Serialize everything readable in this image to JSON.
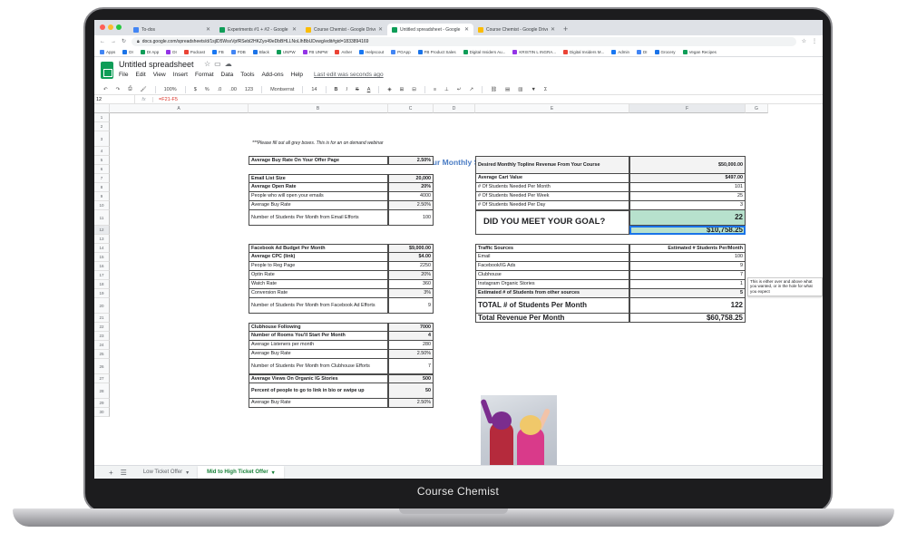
{
  "device_label": "Course Chemist",
  "browser": {
    "tabs": [
      {
        "label": "To-dos",
        "color": "#4285f4"
      },
      {
        "label": "Experiments #1 + #2 - Google",
        "color": "#0f9d58"
      },
      {
        "label": "Course Chemist - Google Drive",
        "color": "#fbbc04"
      },
      {
        "label": "Untitled spreadsheet - Google",
        "color": "#0f9d58"
      },
      {
        "label": "Course Chemist - Google Drive",
        "color": "#fbbc04"
      }
    ],
    "url": "docs.google.com/spreadsheets/d/1sjlD5WsxVpfRSebl2HKZyo49eDbBHLLNoLlhBbUDvwg/edit#gid=1833894169",
    "bookmarks": [
      "Apps",
      "DI",
      "DI App",
      "DI",
      "Podcast",
      "FB",
      "FDB",
      "Black",
      "UNPW",
      "FB UNPW",
      "Asher",
      "Helpscout",
      "PGApp",
      "FB Product Sales",
      "Digital Insiders Au...",
      "KRISTIN L INGRA...",
      "Digital Insiders M...",
      "Admin",
      "DI",
      "Grocery",
      "Vegan Recipes"
    ]
  },
  "sheets": {
    "title": "Untitled spreadsheet",
    "menu": [
      "File",
      "Edit",
      "View",
      "Insert",
      "Format",
      "Data",
      "Tools",
      "Add-ons",
      "Help"
    ],
    "last_edit": "Last edit was seconds ago",
    "toolbar": {
      "zoom": "100%",
      "currency": "$",
      "percent": "%",
      "dec_less": ".0",
      "dec_more": ".00",
      "format": "123",
      "font": "Montserrat",
      "size": "14",
      "bold": "B",
      "italic": "I",
      "strike": "S",
      "textcolor": "A",
      "sigma": "Σ"
    },
    "name_box": "12",
    "formula": "=F21-F5",
    "columns": [
      "A",
      "B",
      "C",
      "D",
      "E",
      "F",
      "G"
    ],
    "rows": [
      "1",
      "2",
      "3",
      "4",
      "5",
      "6",
      "7",
      "8",
      "9",
      "10",
      "11",
      "12",
      "13",
      "14",
      "15",
      "16",
      "17",
      "18",
      "19",
      "20",
      "21",
      "22",
      "23",
      "24",
      "25",
      "26",
      "27",
      "28",
      "29",
      "30"
    ],
    "heading": "Estimate Your Monthly Sales Based on Traffic Efforts",
    "instructions": "***Please fill out all grey boxes. This is for an on demand webinar",
    "buy_rate": {
      "label": "Average Buy Rate On Your Offer Page",
      "value": "2.50%"
    },
    "email": {
      "header": {
        "label": "Email List Size",
        "value": "20,000"
      },
      "rows": [
        {
          "label": "Average Open Rate",
          "value": "20%"
        },
        {
          "label": "People who will open your emails",
          "value": "4000"
        },
        {
          "label": "Average Buy Rate",
          "value": "2.50%"
        },
        {
          "label": "Number of Students Per Month from Email Efforts",
          "value": "100"
        }
      ]
    },
    "facebook": {
      "header": {
        "label": "Facebook Ad Budget Per Month",
        "value": "$9,000.00"
      },
      "rows": [
        {
          "label": "Average CPC (link)",
          "value": "$4.00"
        },
        {
          "label": "People to Reg Page",
          "value": "2250"
        },
        {
          "label": "Optin Rate",
          "value": "20%"
        },
        {
          "label": "Watch Rate",
          "value": "360"
        },
        {
          "label": "Conversion Rate",
          "value": "3%"
        },
        {
          "label": "Number of Students Per Month from Facebook Ad Efforts",
          "value": "9"
        }
      ]
    },
    "clubhouse": {
      "header": {
        "label": "Clubhouse Following",
        "value": "7000"
      },
      "rows": [
        {
          "label": "Number of Rooms You'll Start Per Month",
          "value": "4"
        },
        {
          "label": "Average Listeners per month",
          "value": "280"
        },
        {
          "label": "Average Buy Rate",
          "value": "2.50%"
        },
        {
          "label": "Number of Students Per Month from Clubhouse Efforts",
          "value": "7"
        }
      ]
    },
    "ig": {
      "header": {
        "label": "Average Views On Organic IG Stories",
        "value": "500"
      },
      "rows": [
        {
          "label": "Percent of people to go to link in bio or swipe up",
          "value": "50"
        },
        {
          "label": "Average Buy Rate",
          "value": "2.50%"
        }
      ]
    },
    "goal": {
      "revenue_label": "Desired Monthly Topline Revenue From Your Course",
      "revenue_value": "$50,000.00",
      "cart_label": "Average Cart Value",
      "cart_value": "$497.00",
      "month_label": "# Of Students Needed Per Month",
      "month_value": "101",
      "week_label": "# Of Students Needed Per Week",
      "week_value": "25",
      "day_label": "# Of Students Needed Per Day",
      "day_value": "3",
      "question": "DID YOU MEET YOUR GOAL?",
      "goal_value_1": "22",
      "goal_value_2": "$10,758.25"
    },
    "note": "This is either over and above what you wanted, or in the hole for what you expect",
    "traffic": {
      "header_label": "Traffic Sources",
      "header_value": "Estimated # Students Per/Month",
      "rows": [
        {
          "label": "Email",
          "value": "100"
        },
        {
          "label": "Facebook/IG Ads",
          "value": "9"
        },
        {
          "label": "Clubhouse",
          "value": "7"
        },
        {
          "label": "Instagram Organic Stories",
          "value": "1"
        }
      ],
      "other_label": "Estimated # of Students from other sources",
      "other_value": "5",
      "total_label": "TOTAL # of Students Per Month",
      "total_value": "122",
      "revenue_label": "Total Revenue Per Month",
      "revenue_value": "$60,758.25"
    },
    "sheet_tabs": [
      "Low Ticket Offer",
      "Mid to High Ticket Offer"
    ]
  },
  "colors": {
    "accent_green": "#0f9d58",
    "goal_fill": "#b7e1cd",
    "heading_blue": "#4a7cc4"
  }
}
